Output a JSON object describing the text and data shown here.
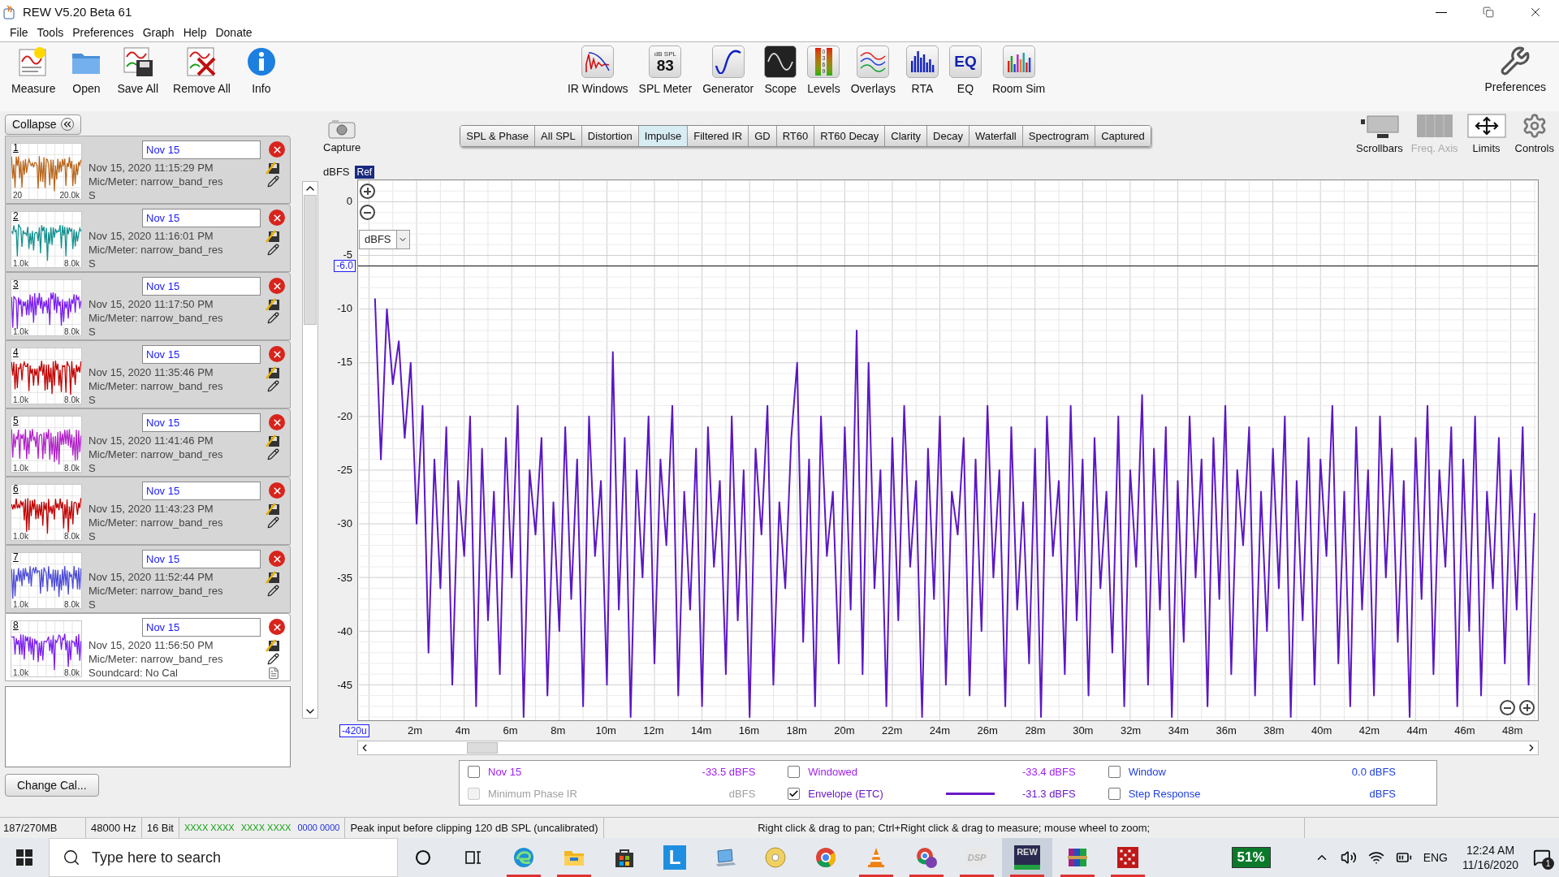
{
  "window": {
    "title": "REW V5.20 Beta 61"
  },
  "menu": [
    "File",
    "Tools",
    "Preferences",
    "Graph",
    "Help",
    "Donate"
  ],
  "toolbar_left": [
    {
      "label": "Measure"
    },
    {
      "label": "Open"
    },
    {
      "label": "Save All"
    },
    {
      "label": "Remove All"
    },
    {
      "label": "Info"
    }
  ],
  "toolbar_middle": [
    {
      "label": "IR Windows"
    },
    {
      "label": "SPL Meter",
      "icon_text": [
        "dB SPL",
        "83"
      ]
    },
    {
      "label": "Generator"
    },
    {
      "label": "Scope"
    },
    {
      "label": "Levels",
      "icon_text": [
        "0",
        "3",
        "6",
        "9"
      ]
    },
    {
      "label": "Overlays"
    },
    {
      "label": "RTA"
    },
    {
      "label": "EQ",
      "icon_text": [
        "EQ"
      ]
    },
    {
      "label": "Room Sim"
    }
  ],
  "toolbar_right": {
    "label": "Preferences"
  },
  "panel": {
    "collapse": "Collapse",
    "change_cal": "Change Cal...",
    "measurements": [
      {
        "number": "1",
        "name": "Nov 15",
        "date": "Nov 15, 2020 11:15:29 PM",
        "mic": "Mic/Meter: narrow_band_res",
        "soundcard": "S",
        "thumb_labels": [
          "20",
          "20.0k"
        ],
        "color": "#b8651a",
        "selected": false
      },
      {
        "number": "2",
        "name": "Nov 15",
        "date": "Nov 15, 2020 11:16:01 PM",
        "mic": "Mic/Meter: narrow_band_res",
        "soundcard": "S",
        "thumb_labels": [
          "1.0k",
          "8.0k"
        ],
        "color": "#12908e",
        "selected": false
      },
      {
        "number": "3",
        "name": "Nov 15",
        "date": "Nov 15, 2020 11:17:50 PM",
        "mic": "Mic/Meter: narrow_band_res",
        "soundcard": "S",
        "thumb_labels": [
          "1.0k",
          "8.0k"
        ],
        "color": "#7a1cf0",
        "selected": false
      },
      {
        "number": "4",
        "name": "Nov 15",
        "date": "Nov 15, 2020 11:35:46 PM",
        "mic": "Mic/Meter: narrow_band_res",
        "soundcard": "S",
        "thumb_labels": [
          "1.0k",
          "8.0k"
        ],
        "color": "#c00000",
        "selected": false
      },
      {
        "number": "5",
        "name": "Nov 15",
        "date": "Nov 15, 2020 11:41:46 PM",
        "mic": "Mic/Meter: narrow_band_res",
        "soundcard": "S",
        "thumb_labels": [
          "1.0k",
          "8.0k"
        ],
        "color": "#b020c8",
        "selected": false
      },
      {
        "number": "6",
        "name": "Nov 15",
        "date": "Nov 15, 2020 11:43:23 PM",
        "mic": "Mic/Meter: narrow_band_res",
        "soundcard": "S",
        "thumb_labels": [
          "1.0k",
          "8.0k"
        ],
        "color": "#c00000",
        "selected": false
      },
      {
        "number": "7",
        "name": "Nov 15",
        "date": "Nov 15, 2020 11:52:44 PM",
        "mic": "Mic/Meter: narrow_band_res",
        "soundcard": "S",
        "thumb_labels": [
          "1.0k",
          "8.0k"
        ],
        "color": "#4b4bd6",
        "selected": false
      },
      {
        "number": "8",
        "name": "Nov 15",
        "date": "Nov 15, 2020 11:56:50 PM",
        "mic": "Mic/Meter: narrow_band_res",
        "soundcard": "Soundcard: No Cal",
        "thumb_labels": [
          "1.0k",
          "8.0k"
        ],
        "color": "#7a1cf0",
        "selected": true
      }
    ]
  },
  "graph": {
    "capture": "Capture",
    "tabs": [
      {
        "label": "SPL & Phase",
        "selected": false
      },
      {
        "label": "All SPL",
        "selected": false
      },
      {
        "label": "Distortion",
        "selected": false
      },
      {
        "label": "Impulse",
        "selected": true
      },
      {
        "label": "Filtered IR",
        "selected": false
      },
      {
        "label": "GD",
        "selected": false
      },
      {
        "label": "RT60",
        "selected": false
      },
      {
        "label": "RT60 Decay",
        "selected": false
      },
      {
        "label": "Clarity",
        "selected": false
      },
      {
        "label": "Decay",
        "selected": false
      },
      {
        "label": "Waterfall",
        "selected": false
      },
      {
        "label": "Spectrogram",
        "selected": false
      },
      {
        "label": "Captured",
        "selected": false
      }
    ],
    "controls": [
      {
        "label": "Scrollbars",
        "disabled": false
      },
      {
        "label": "Freq. Axis",
        "disabled": true
      },
      {
        "label": "Limits",
        "disabled": false
      },
      {
        "label": "Controls",
        "disabled": false
      }
    ],
    "y_unit": "dBFS",
    "ref": "Ref",
    "unit_select": "dBFS",
    "x_start": "-420u",
    "chart_data": {
      "type": "line",
      "xlim": [
        -0.42,
        49.1
      ],
      "ylim": [
        -48.3,
        2
      ],
      "grid": true,
      "ref_lines": [
        {
          "axis": "y",
          "value": -6,
          "label": "-6.0"
        }
      ],
      "yticks": [
        0,
        -5,
        -10,
        -15,
        -20,
        -25,
        -30,
        -35,
        -40,
        -45
      ],
      "xticks": [
        {
          "value": 2,
          "label": "2m"
        },
        {
          "value": 4,
          "label": "4m"
        },
        {
          "value": 6,
          "label": "6m"
        },
        {
          "value": 8,
          "label": "8m"
        },
        {
          "value": 10,
          "label": "10m"
        },
        {
          "value": 12,
          "label": "12m"
        },
        {
          "value": 14,
          "label": "14m"
        },
        {
          "value": 16,
          "label": "16m"
        },
        {
          "value": 18,
          "label": "18m"
        },
        {
          "value": 20,
          "label": "20m"
        },
        {
          "value": 22,
          "label": "22m"
        },
        {
          "value": 24,
          "label": "24m"
        },
        {
          "value": 26,
          "label": "26m"
        },
        {
          "value": 28,
          "label": "28m"
        },
        {
          "value": 30,
          "label": "30m"
        },
        {
          "value": 32,
          "label": "32m"
        },
        {
          "value": 34,
          "label": "34m"
        },
        {
          "value": 36,
          "label": "36m"
        },
        {
          "value": 38,
          "label": "38m"
        },
        {
          "value": 40,
          "label": "40m"
        },
        {
          "value": 42,
          "label": "42m"
        },
        {
          "value": 44,
          "label": "44m"
        },
        {
          "value": 46,
          "label": "46m"
        },
        {
          "value": 48,
          "label": "48m"
        }
      ],
      "x": [
        0.25,
        0.5,
        0.75,
        1,
        1.25,
        1.5,
        1.75,
        2,
        2.25,
        2.5,
        2.75,
        3,
        3.25,
        3.5,
        3.75,
        4,
        4.25,
        4.5,
        4.75,
        5,
        5.25,
        5.5,
        5.75,
        6,
        6.25,
        6.5,
        6.75,
        7,
        7.25,
        7.5,
        7.75,
        8,
        8.25,
        8.5,
        8.75,
        9,
        9.25,
        9.5,
        9.75,
        10,
        10.25,
        10.5,
        10.75,
        11,
        11.25,
        11.5,
        11.75,
        12,
        12.25,
        12.5,
        12.75,
        13,
        13.25,
        13.5,
        13.75,
        14,
        14.25,
        14.5,
        14.75,
        15,
        15.25,
        15.5,
        15.75,
        16,
        16.25,
        16.5,
        16.75,
        17,
        17.25,
        17.5,
        17.75,
        18,
        18.25,
        18.5,
        18.75,
        19,
        19.25,
        19.5,
        19.75,
        20,
        20.25,
        20.5,
        20.75,
        21,
        21.25,
        21.5,
        21.75,
        22,
        22.25,
        22.5,
        22.75,
        23,
        23.25,
        23.5,
        23.75,
        24,
        24.25,
        24.5,
        24.75,
        25,
        25.25,
        25.5,
        25.75,
        26,
        26.25,
        26.5,
        26.75,
        27,
        27.25,
        27.5,
        27.75,
        28,
        28.25,
        28.5,
        28.75,
        29,
        29.25,
        29.5,
        29.75,
        30,
        30.25,
        30.5,
        30.75,
        31,
        31.25,
        31.5,
        31.75,
        32,
        32.25,
        32.5,
        32.75,
        33,
        33.25,
        33.5,
        33.75,
        34,
        34.25,
        34.5,
        34.75,
        35,
        35.25,
        35.5,
        35.75,
        36,
        36.25,
        36.5,
        36.75,
        37,
        37.25,
        37.5,
        37.75,
        38,
        38.25,
        38.5,
        38.75,
        39,
        39.25,
        39.5,
        39.75,
        40,
        40.25,
        40.5,
        40.75,
        41,
        41.25,
        41.5,
        41.75,
        42,
        42.25,
        42.5,
        42.75,
        43,
        43.25,
        43.5,
        43.75,
        44,
        44.25,
        44.5,
        44.75,
        45,
        45.25,
        45.5,
        45.75,
        46,
        46.25,
        46.5,
        46.75,
        47,
        47.25,
        47.5,
        47.75,
        48,
        48.25,
        48.5,
        48.75,
        49
      ],
      "series": [
        {
          "color": "#5b17c4",
          "values": [
            -9,
            -24,
            -10,
            -17,
            -13,
            -22,
            -15,
            -30,
            -19,
            -42,
            -24,
            -36,
            -21,
            -45,
            -26,
            -33,
            -20,
            -47,
            -23,
            -39,
            -27,
            -44,
            -22,
            -35,
            -19,
            -48,
            -25,
            -31,
            -22,
            -46,
            -28,
            -40,
            -21,
            -37,
            -24,
            -47,
            -20,
            -33,
            -26,
            -45,
            -14,
            -38,
            -22,
            -48,
            -25,
            -35,
            -20,
            -43,
            -24,
            -32,
            -19,
            -46,
            -27,
            -38,
            -23,
            -47,
            -21,
            -34,
            -26,
            -44,
            -20,
            -39,
            -25,
            -48,
            -23,
            -31,
            -19,
            -45,
            -28,
            -36,
            -22,
            -15,
            -41,
            -24,
            -47,
            -20,
            -33,
            -27,
            -43,
            -21,
            -38,
            -12,
            -44,
            -15,
            -36,
            -25,
            -47,
            -22,
            -39,
            -19,
            -34,
            -26,
            -48,
            -23,
            -37,
            -20,
            -45,
            -27,
            -31,
            -22,
            -46,
            -24,
            -40,
            -19,
            -35,
            -25,
            -47,
            -21,
            -38,
            -28,
            -43,
            -23,
            -48,
            -20,
            -33,
            -26,
            -44,
            -19,
            -39,
            -24,
            -46,
            -22,
            -36,
            -27,
            -42,
            -20,
            -47,
            -25,
            -34,
            -18,
            -45,
            -23,
            -38,
            -21,
            -48,
            -26,
            -41,
            -20,
            -35,
            -24,
            -47,
            -22,
            -37,
            -19,
            -44,
            -25,
            -32,
            -21,
            -46,
            -27,
            -40,
            -23,
            -36,
            -20,
            -48,
            -26,
            -39,
            -22,
            -45,
            -24,
            -33,
            -19,
            -43,
            -27,
            -47,
            -21,
            -38,
            -25,
            -46,
            -20,
            -35,
            -23,
            -41,
            -26,
            -48,
            -22,
            -37,
            -19,
            -44,
            -25,
            -34,
            -21,
            -47,
            -24,
            -40,
            -20,
            -46,
            -27,
            -36,
            -22,
            -43,
            -25,
            -38,
            -21,
            -45,
            -29
          ]
        }
      ]
    },
    "legend": [
      {
        "label": "Nov 15",
        "value": "-33.5 dBFS",
        "checked": false,
        "disabled": false,
        "swatch": false,
        "color": "#a020f0"
      },
      {
        "label": "Windowed",
        "value": "-33.4 dBFS",
        "checked": false,
        "disabled": false,
        "swatch": false,
        "color": "#a020f0"
      },
      {
        "label": "Window",
        "value": "0.0 dBFS",
        "checked": false,
        "disabled": false,
        "swatch": false,
        "color": "#2040e0"
      },
      {
        "label": "Minimum Phase IR",
        "value": "dBFS",
        "checked": false,
        "disabled": true,
        "swatch": false,
        "color": "#a0a0a0"
      },
      {
        "label": "Envelope (ETC)",
        "value": "-31.3 dBFS",
        "checked": true,
        "disabled": false,
        "swatch": true,
        "color": "#6a18c8"
      },
      {
        "label": "Step Response",
        "value": "dBFS",
        "checked": false,
        "disabled": false,
        "swatch": false,
        "color": "#2040e0"
      }
    ]
  },
  "status_bar": {
    "memory": "187/270MB",
    "rate": "48000 Hz",
    "bits": "16 Bit",
    "input_a": "XXXX XXXX",
    "input_b": "XXXX XXXX",
    "output": "0000 0000",
    "peak": "Peak input before clipping 120 dB SPL (uncalibrated)",
    "hint": "Right click & drag to pan; Ctrl+Right click & drag to measure; mouse wheel to zoom;"
  },
  "taskbar": {
    "search": {
      "placeholder": "Type here to search"
    },
    "apps": [
      {
        "running": false,
        "selected": false
      },
      {
        "running": false,
        "selected": false
      },
      {
        "running": true,
        "selected": false
      },
      {
        "running": true,
        "selected": false
      },
      {
        "running": false,
        "selected": false
      },
      {
        "label": "L",
        "running": false,
        "selected": false
      },
      {
        "running": false,
        "selected": false
      },
      {
        "running": false,
        "selected": false
      },
      {
        "running": false,
        "selected": false
      },
      {
        "running": true,
        "selected": false
      },
      {
        "running": true,
        "selected": false
      },
      {
        "label": "DSP",
        "running": true,
        "selected": false
      },
      {
        "label": "REW",
        "running": true,
        "selected": true
      },
      {
        "running": true,
        "selected": false
      },
      {
        "running": true,
        "selected": false
      }
    ],
    "battery": "51%",
    "language": "ENG",
    "time": "12:24 AM",
    "date": "11/16/2020",
    "notifications": "1"
  }
}
